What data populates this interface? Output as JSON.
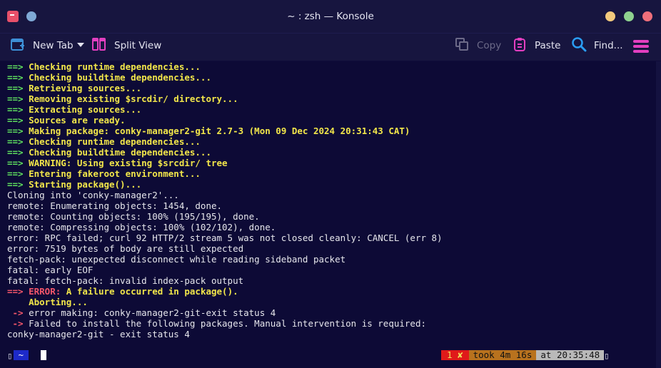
{
  "window": {
    "title": "~ : zsh — Konsole"
  },
  "toolbar": {
    "new_tab": "New Tab",
    "split_view": "Split View",
    "copy": "Copy",
    "paste": "Paste",
    "find": "Find..."
  },
  "colors": {
    "background": "#0d0a36",
    "arrow_green": "#5fe05f",
    "arrow_red": "#f4566a",
    "bold_yellow": "#f2e64a",
    "accent_magenta": "#e33fc0",
    "find_blue": "#2a9df4"
  },
  "terminal": {
    "lines": [
      {
        "arrow": "==>",
        "text": "Checking runtime dependencies..."
      },
      {
        "arrow": "==>",
        "text": "Checking buildtime dependencies..."
      },
      {
        "arrow": "==>",
        "text": "Retrieving sources..."
      },
      {
        "arrow": "==>",
        "text": "Removing existing $srcdir/ directory..."
      },
      {
        "arrow": "==>",
        "text": "Extracting sources..."
      },
      {
        "arrow": "==>",
        "text": "Sources are ready."
      },
      {
        "arrow": "==>",
        "text": "Making package: conky-manager2-git 2.7-3 (Mon 09 Dec 2024 20:31:43 CAT)"
      },
      {
        "arrow": "==>",
        "text": "Checking runtime dependencies..."
      },
      {
        "arrow": "==>",
        "text": "Checking buildtime dependencies..."
      },
      {
        "arrow": "==>",
        "text": "WARNING: Using existing $srcdir/ tree"
      },
      {
        "arrow": "==>",
        "text": "Entering fakeroot environment..."
      },
      {
        "arrow": "==>",
        "text": "Starting package()..."
      },
      {
        "plain": "Cloning into 'conky-manager2'..."
      },
      {
        "plain": "remote: Enumerating objects: 1454, done."
      },
      {
        "plain": "remote: Counting objects: 100% (195/195), done."
      },
      {
        "plain": "remote: Compressing objects: 100% (102/102), done."
      },
      {
        "plain": "error: RPC failed; curl 92 HTTP/2 stream 5 was not closed cleanly: CANCEL (err 8)"
      },
      {
        "plain": "error: 7519 bytes of body are still expected"
      },
      {
        "plain": "fetch-pack: unexpected disconnect while reading sideband packet"
      },
      {
        "plain": "fatal: early EOF"
      },
      {
        "plain": "fatal: fetch-pack: invalid index-pack output"
      }
    ],
    "error_line": {
      "arrow": "==>",
      "label": "ERROR:",
      "text": "A failure occurred in package()."
    },
    "aborting": "    Aborting...",
    "sub_lines": [
      {
        "arrow": " ->",
        "text": "error making: conky-manager2-git-exit status 4"
      },
      {
        "arrow": " ->",
        "text": "Failed to install the following packages. Manual intervention is required:"
      }
    ],
    "last_line": "conky-manager2-git - exit status 4"
  },
  "prompt": {
    "left_cap": "▯",
    "dir": "~",
    "status_code": "1 ✘",
    "took": "took 4m 16s",
    "time": "at 20:35:48",
    "right_cap": "▯"
  }
}
